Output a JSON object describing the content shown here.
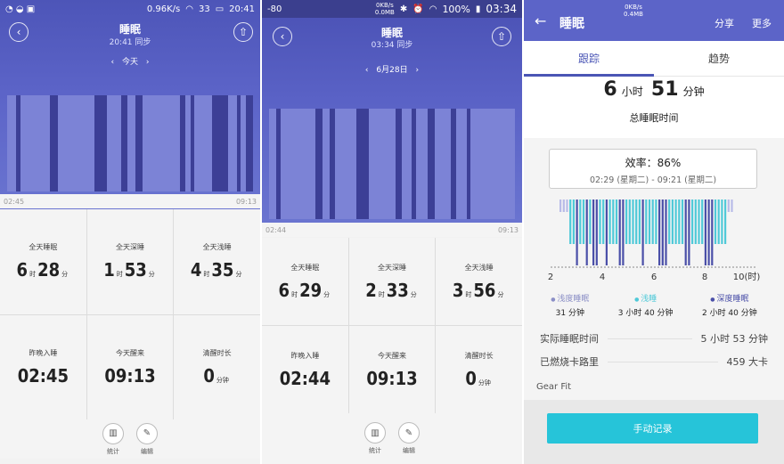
{
  "panel1": {
    "status": {
      "left_icons": "◔ ◒ ▣",
      "speed": "0.96K/s",
      "signal": "33",
      "time": "20:41"
    },
    "title": "睡眠",
    "sync": "20:41 同步",
    "date_label": "今天",
    "start_time": "02:45",
    "end_time": "09:13",
    "stats": [
      {
        "label": "全天睡眠",
        "h": "6",
        "m": "28",
        "hu": "时",
        "mu": "分"
      },
      {
        "label": "全天深睡",
        "h": "1",
        "m": "53",
        "hu": "时",
        "mu": "分"
      },
      {
        "label": "全天浅睡",
        "h": "4",
        "m": "35",
        "hu": "时",
        "mu": "分"
      },
      {
        "label": "昨晚入睡",
        "value": "02:45"
      },
      {
        "label": "今天醒来",
        "value": "09:13"
      },
      {
        "label": "清醒时长",
        "value": "0",
        "unit": "分钟"
      }
    ],
    "bottom": [
      {
        "label": "统计",
        "icon": "bar-chart-icon"
      },
      {
        "label": "编辑",
        "icon": "edit-icon"
      }
    ]
  },
  "panel2": {
    "status": {
      "left": "-80",
      "speed_top": "0KB/s",
      "speed_bottom": "0.0MB",
      "battery": "100%",
      "time": "03:34"
    },
    "title": "睡眠",
    "sync": "03:34 同步",
    "date_label": "6月28日",
    "start_time": "02:44",
    "end_time": "09:13",
    "stats": [
      {
        "label": "全天睡眠",
        "h": "6",
        "m": "29",
        "hu": "时",
        "mu": "分"
      },
      {
        "label": "全天深睡",
        "h": "2",
        "m": "33",
        "hu": "时",
        "mu": "分"
      },
      {
        "label": "全天浅睡",
        "h": "3",
        "m": "56",
        "hu": "时",
        "mu": "分"
      },
      {
        "label": "昨晚入睡",
        "value": "02:44"
      },
      {
        "label": "今天醒来",
        "value": "09:13"
      },
      {
        "label": "清醒时长",
        "value": "0",
        "unit": "分钟"
      }
    ],
    "bottom": [
      {
        "label": "统计",
        "icon": "bar-chart-icon"
      },
      {
        "label": "编辑",
        "icon": "edit-icon"
      }
    ]
  },
  "panel3": {
    "status": {
      "speed_top": "0KB/s",
      "speed_bottom": "0.4MB"
    },
    "title": "睡眠",
    "share": "分享",
    "more": "更多",
    "tabs": [
      "跟踪",
      "趋势"
    ],
    "total": {
      "h": "6",
      "hu": "小时",
      "m": "51",
      "mu": "分钟"
    },
    "total_label": "总睡眠时间",
    "efficiency": "效率：86%",
    "range": "02:29 (星期二) - 09:21 (星期二)",
    "axis_ticks": [
      "2",
      "4",
      "6",
      "8",
      "10(时)"
    ],
    "legend": [
      {
        "name": "浅度睡眠",
        "value": "31 分钟",
        "color": "#b8bbe8"
      },
      {
        "name": "浅睡",
        "value": "3 小时 40 分钟",
        "color": "#4fc9d8"
      },
      {
        "name": "深度睡眠",
        "value": "2 小时 40 分钟",
        "color": "#4a4fa8"
      }
    ],
    "actual_label": "实际睡眠时间",
    "actual_value": "5 小时 53 分钟",
    "calorie_label": "已燃烧卡路里",
    "calorie_value": "459 大卡",
    "device": "Gear Fit",
    "manual_button": "手动记录"
  },
  "colors": {
    "header": "#5c64c8",
    "light_bar": "#7c83d6",
    "deep_bar": "#3c3f96",
    "teal": "#4fc9d8",
    "button": "#26c4d9"
  }
}
